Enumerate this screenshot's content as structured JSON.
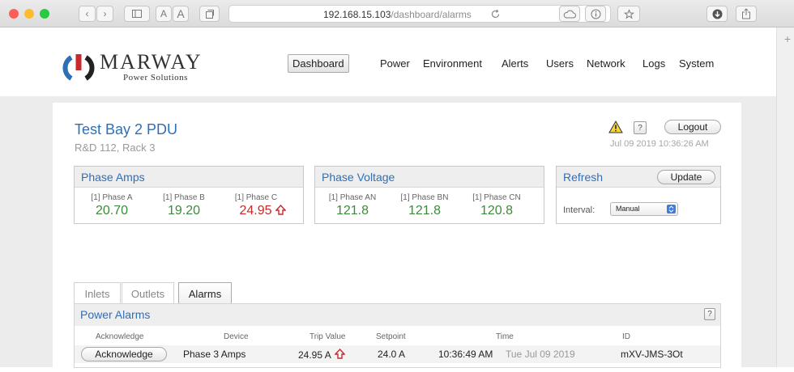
{
  "browser": {
    "url_host": "192.168.15.103",
    "url_path": "/dashboard/alarms",
    "reader_font_small": "A",
    "reader_font_large": "A"
  },
  "logo": {
    "title": "MARWAY",
    "subtitle": "Power Solutions"
  },
  "nav": [
    {
      "label": "Dashboard",
      "active": true
    },
    {
      "label": "Power"
    },
    {
      "label": "Environment"
    },
    {
      "label": "Alerts"
    },
    {
      "label": "Users"
    },
    {
      "label": "Network"
    },
    {
      "label": "Logs"
    },
    {
      "label": "System"
    }
  ],
  "device": {
    "name": "Test Bay 2 PDU",
    "location": "R&D 112, Rack 3"
  },
  "header_actions": {
    "help": "?",
    "logout": "Logout",
    "timestamp": "Jul 09 2019 10:36:26 AM"
  },
  "phase_amps": {
    "title": "Phase Amps",
    "items": [
      {
        "label": "[1] Phase A",
        "value": "20.70",
        "alarm": false
      },
      {
        "label": "[1] Phase B",
        "value": "19.20",
        "alarm": false
      },
      {
        "label": "[1] Phase C",
        "value": "24.95",
        "alarm": true
      }
    ]
  },
  "phase_voltage": {
    "title": "Phase Voltage",
    "items": [
      {
        "label": "[1] Phase AN",
        "value": "121.8"
      },
      {
        "label": "[1] Phase BN",
        "value": "121.8"
      },
      {
        "label": "[1] Phase CN",
        "value": "120.8"
      }
    ]
  },
  "refresh": {
    "title": "Refresh",
    "update": "Update",
    "interval_label": "Interval:",
    "interval_value": "Manual"
  },
  "tabs": [
    {
      "label": "Inlets"
    },
    {
      "label": "Outlets"
    },
    {
      "label": "Alarms",
      "active": true
    }
  ],
  "alarms": {
    "title": "Power Alarms",
    "help": "?",
    "columns": [
      "Acknowledge",
      "Device",
      "Trip Value",
      "Setpoint",
      "Time",
      "ID"
    ],
    "rows": [
      {
        "ack": "Acknowledge",
        "device": "Phase 3 Amps",
        "trip_value": "24.95 A",
        "setpoint": "24.0 A",
        "time": "10:36:49 AM",
        "date": "Tue Jul 09 2019",
        "id": "mXV-JMS-3Ot"
      }
    ]
  },
  "colors": {
    "accent": "#2f6fb6",
    "ok": "#3c8a3c",
    "alarm": "#c62a2a"
  }
}
